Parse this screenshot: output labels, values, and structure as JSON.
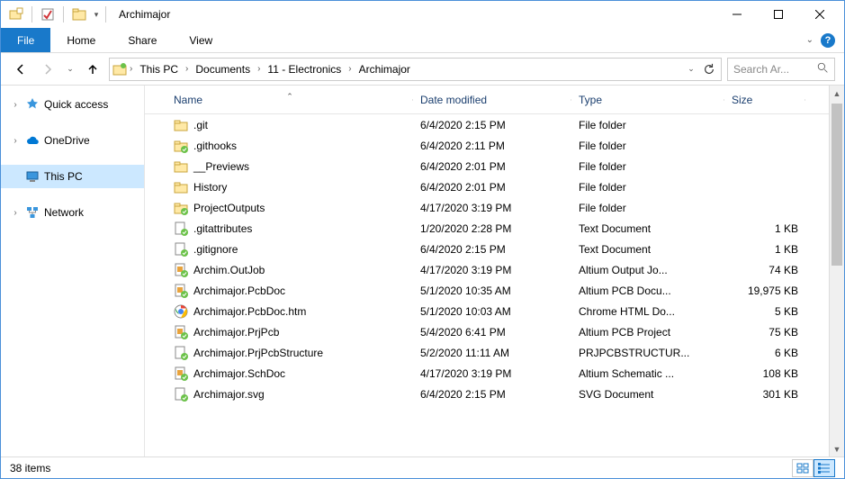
{
  "window": {
    "title": "Archimajor"
  },
  "ribbon": {
    "file": "File",
    "tabs": [
      "Home",
      "Share",
      "View"
    ]
  },
  "nav": {
    "crumbs": [
      "This PC",
      "Documents",
      "11 - Electronics",
      "Archimajor"
    ],
    "search_placeholder": "Search Ar..."
  },
  "tree": {
    "items": [
      {
        "label": "Quick access",
        "icon": "star"
      },
      {
        "label": "OneDrive",
        "icon": "cloud"
      },
      {
        "label": "This PC",
        "icon": "pc",
        "selected": true
      },
      {
        "label": "Network",
        "icon": "network"
      }
    ]
  },
  "columns": {
    "name": "Name",
    "date": "Date modified",
    "type": "Type",
    "size": "Size"
  },
  "rows": [
    {
      "name": ".git",
      "date": "6/4/2020 2:15 PM",
      "type": "File folder",
      "size": "",
      "icon": "folder"
    },
    {
      "name": ".githooks",
      "date": "6/4/2020 2:11 PM",
      "type": "File folder",
      "size": "",
      "icon": "folder-sync"
    },
    {
      "name": "__Previews",
      "date": "6/4/2020 2:01 PM",
      "type": "File folder",
      "size": "",
      "icon": "folder"
    },
    {
      "name": "History",
      "date": "6/4/2020 2:01 PM",
      "type": "File folder",
      "size": "",
      "icon": "folder"
    },
    {
      "name": "ProjectOutputs",
      "date": "4/17/2020 3:19 PM",
      "type": "File folder",
      "size": "",
      "icon": "folder-sync"
    },
    {
      "name": ".gitattributes",
      "date": "1/20/2020 2:28 PM",
      "type": "Text Document",
      "size": "1 KB",
      "icon": "file-sync"
    },
    {
      "name": ".gitignore",
      "date": "6/4/2020 2:15 PM",
      "type": "Text Document",
      "size": "1 KB",
      "icon": "file-sync"
    },
    {
      "name": "Archim.OutJob",
      "date": "4/17/2020 3:19 PM",
      "type": "Altium Output Jo...",
      "size": "74 KB",
      "icon": "altium"
    },
    {
      "name": "Archimajor.PcbDoc",
      "date": "5/1/2020 10:35 AM",
      "type": "Altium PCB Docu...",
      "size": "19,975 KB",
      "icon": "altium"
    },
    {
      "name": "Archimajor.PcbDoc.htm",
      "date": "5/1/2020 10:03 AM",
      "type": "Chrome HTML Do...",
      "size": "5 KB",
      "icon": "chrome"
    },
    {
      "name": "Archimajor.PrjPcb",
      "date": "5/4/2020 6:41 PM",
      "type": "Altium PCB Project",
      "size": "75 KB",
      "icon": "altium"
    },
    {
      "name": "Archimajor.PrjPcbStructure",
      "date": "5/2/2020 11:11 AM",
      "type": "PRJPCBSTRUCTUR...",
      "size": "6 KB",
      "icon": "file-sync"
    },
    {
      "name": "Archimajor.SchDoc",
      "date": "4/17/2020 3:19 PM",
      "type": "Altium Schematic ...",
      "size": "108 KB",
      "icon": "altium"
    },
    {
      "name": "Archimajor.svg",
      "date": "6/4/2020 2:15 PM",
      "type": "SVG Document",
      "size": "301 KB",
      "icon": "file-sync"
    }
  ],
  "status": {
    "count": "38 items"
  }
}
